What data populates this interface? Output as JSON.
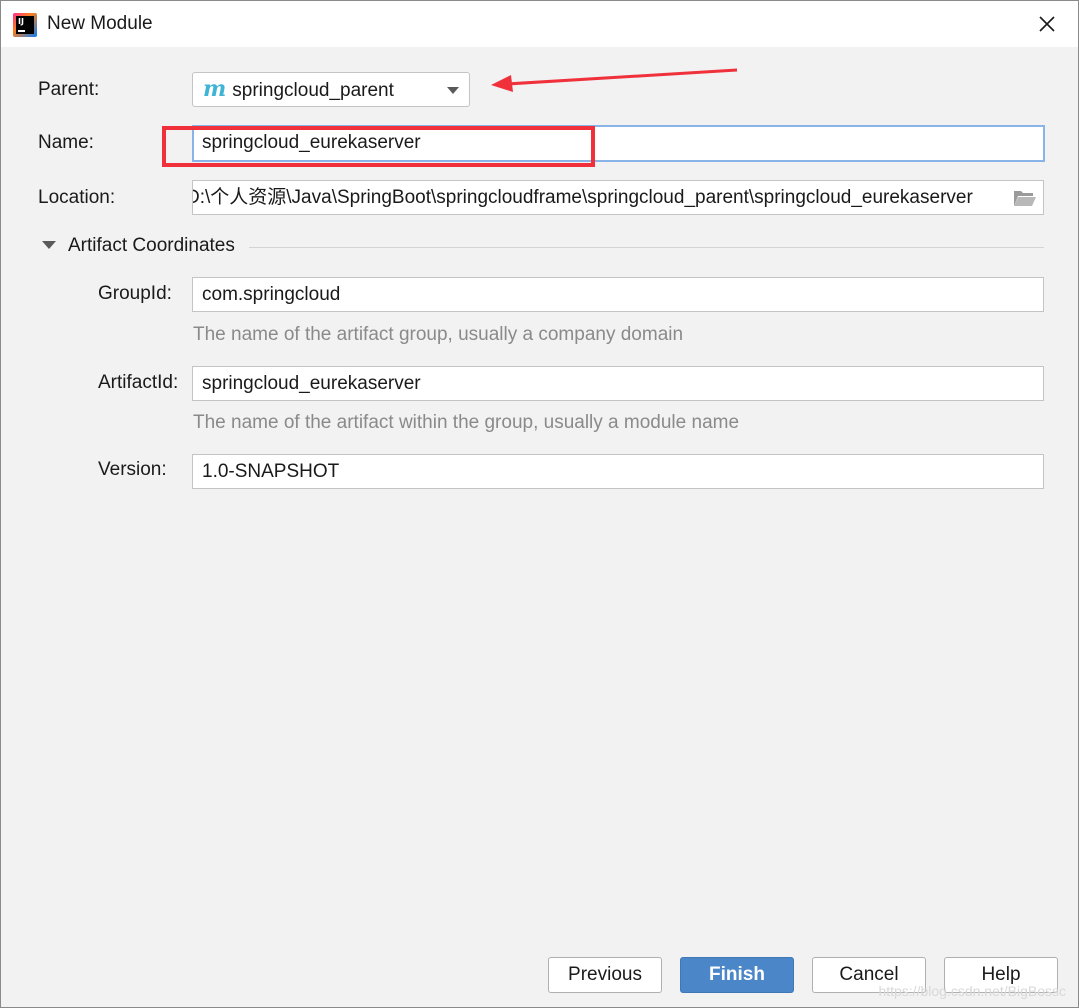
{
  "window": {
    "title": "New Module",
    "app_icon_text": "IJ"
  },
  "form": {
    "parent_label": "Parent:",
    "parent_value": "springcloud_parent",
    "parent_icon_letter": "m",
    "name_label": "Name:",
    "name_value": "springcloud_eurekaserver",
    "location_label": "Location:",
    "location_value": "D:\\个人资源\\Java\\SpringBoot\\springcloudframe\\springcloud_parent\\springcloud_eurekaserver"
  },
  "artifact": {
    "section_title": "Artifact Coordinates",
    "groupid_label": "GroupId:",
    "groupid_value": "com.springcloud",
    "groupid_hint": "The name of the artifact group, usually a company domain",
    "artifactid_label": "ArtifactId:",
    "artifactid_value": "springcloud_eurekaserver",
    "artifactid_hint": "The name of the artifact within the group, usually a module name",
    "version_label": "Version:",
    "version_value": "1.0-SNAPSHOT"
  },
  "buttons": {
    "previous": "Previous",
    "finish": "Finish",
    "cancel": "Cancel",
    "help": "Help"
  },
  "watermark": "https://blog.csdn.net/BigBossc",
  "colors": {
    "accent": "#4a86c8",
    "annotation_red": "#f0313c",
    "focus_border": "#8ab4e8",
    "maven_icon": "#3fb4d4"
  }
}
